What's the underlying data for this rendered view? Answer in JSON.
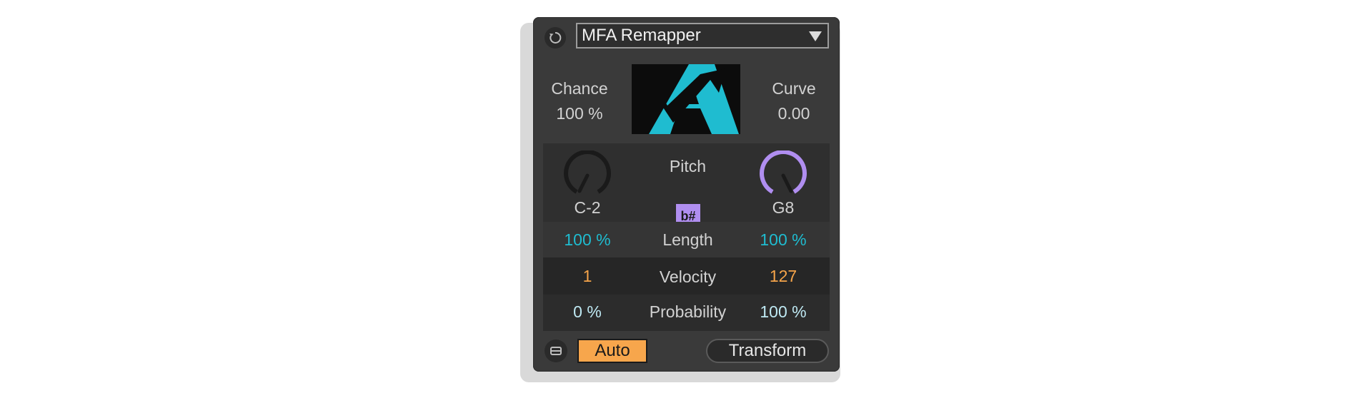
{
  "device": {
    "title": "MFA Remapper",
    "power_icon": "power-icon",
    "chance": {
      "label": "Chance",
      "value": "100 %"
    },
    "curve": {
      "label": "Curve",
      "value": "0.00"
    },
    "pitch": {
      "label": "Pitch",
      "low": "C-2",
      "high": "G8",
      "accidental_label": "b#",
      "accent_color": "#b08ef0"
    },
    "length": {
      "label": "Length",
      "low": "100 %",
      "high": "100 %",
      "color": "#1fbcd0"
    },
    "velocity": {
      "label": "Velocity",
      "low": "1",
      "high": "127",
      "color": "#f5a44a"
    },
    "probability": {
      "label": "Probability",
      "low": "0 %",
      "high": "100 %",
      "color": "#bfe9f3"
    },
    "auto_button": "Auto",
    "transform_button": "Transform",
    "chain_icon": "chain-icon"
  }
}
